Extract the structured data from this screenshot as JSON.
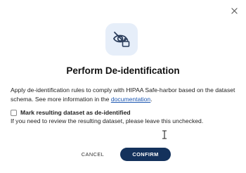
{
  "dialog": {
    "icon": "visibility-off-lock-icon",
    "title": "Perform De-identification",
    "description_before_link": "Apply de-identification rules to comply with HIPAA Safe-harbor based on the dataset schema. See more information in the ",
    "link_text": "documentation",
    "description_after_link": ".",
    "checkbox_label": "Mark resulting dataset as de-identified",
    "checkbox_checked": false,
    "hint": "If you need to review the resulting dataset, please leave this unchecked.",
    "cancel_label": "CANCEL",
    "confirm_label": "CONFIRM",
    "close_icon": "close-icon"
  },
  "colors": {
    "primary": "#14325c",
    "link": "#1a55b0",
    "icon_bg": "#e6eef9"
  }
}
